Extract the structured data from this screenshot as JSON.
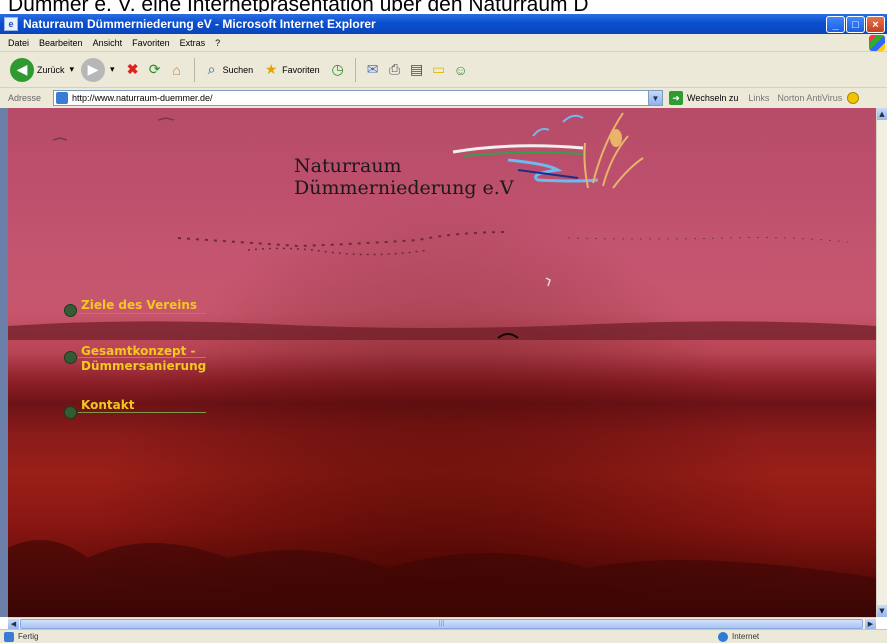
{
  "caption": "Dümmer e. V. eine Internetpräsentation über den Naturraum D",
  "window": {
    "title": "Naturraum Dümmerniederung eV - Microsoft Internet Explorer",
    "minimize": "_",
    "maximize": "□",
    "close": "×"
  },
  "menu": [
    "Datei",
    "Bearbeiten",
    "Ansicht",
    "Favoriten",
    "Extras",
    "?"
  ],
  "toolbar": {
    "back_label": "Zurück",
    "search_label": "Suchen",
    "favorites_label": "Favoriten"
  },
  "address": {
    "label": "Adresse",
    "url": "http://www.naturraum-duemmer.de/",
    "go_label": "Wechseln zu",
    "links_label": "Links",
    "norton_label": "Norton AntiVirus"
  },
  "site": {
    "title_line1": "Naturraum",
    "title_line2": "Dümmerniederung e.V"
  },
  "nav": [
    {
      "label_line1": "Ziele des Vereins",
      "label_line2": ""
    },
    {
      "label_line1": "Gesamtkonzept -",
      "label_line2": "Dümmersanierung"
    },
    {
      "label_line1": "Kontakt",
      "label_line2": ""
    }
  ],
  "status": {
    "text": "Fertig",
    "zone": "Internet"
  },
  "colors": {
    "nav_text": "#f2c81e",
    "nav_dot": "#335c33",
    "title_bar": "#0a4fd0"
  }
}
